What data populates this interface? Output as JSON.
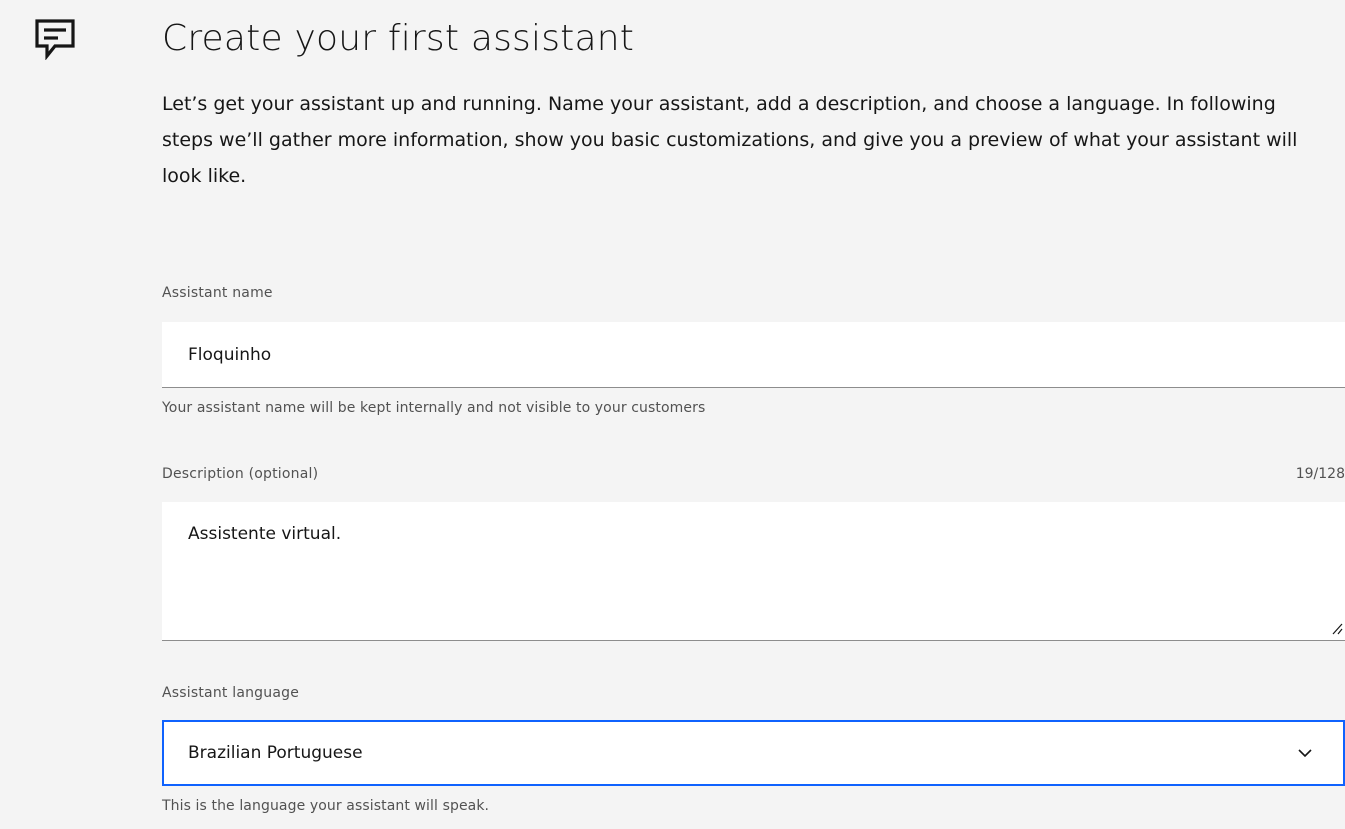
{
  "header": {
    "title": "Create your first assistant",
    "icon": "chat-icon",
    "intro": "Let’s get your assistant up and running. Name your assistant, add a description, and choose a language. In following steps we’ll gather more information, show you basic customizations, and give you a preview of what your assistant will look like."
  },
  "form": {
    "name": {
      "label": "Assistant name",
      "value": "Floquinho",
      "helper": "Your assistant name will be kept internally and not visible to your customers"
    },
    "description": {
      "label": "Description (optional)",
      "counter": "19/128",
      "value": "Assistente virtual."
    },
    "language": {
      "label": "Assistant language",
      "selected": "Brazilian Portuguese",
      "helper": "This is the language your assistant will speak.",
      "icon": "chevron-down-icon"
    }
  },
  "colors": {
    "background": "#f4f4f4",
    "focus": "#0f62fe",
    "text": "#161616",
    "secondary_text": "#525252"
  }
}
